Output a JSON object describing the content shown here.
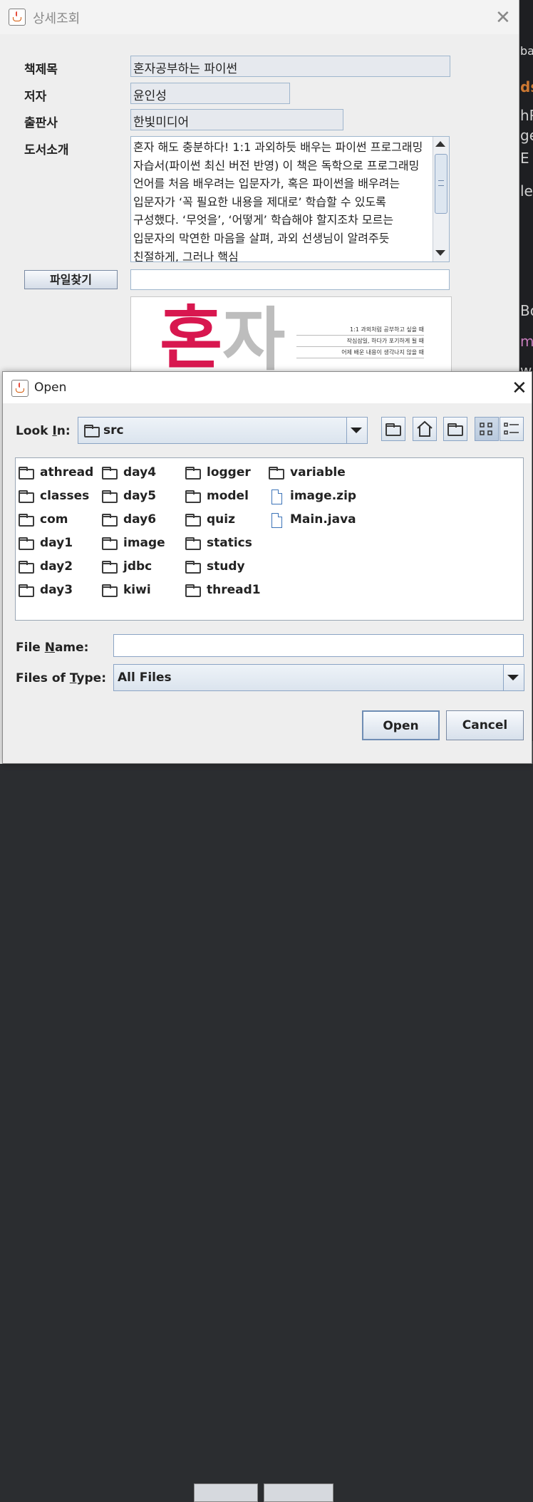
{
  "detail_window": {
    "title": "상세조회",
    "close_glyph": "✕",
    "fields": {
      "title_label": "책제목",
      "title_value": "혼자공부하는 파이썬",
      "author_label": "저자",
      "author_value": "윤인성",
      "publisher_label": "출판사",
      "publisher_value": "한빛미디어",
      "intro_label": "도서소개",
      "intro_text": "혼자 해도 충분하다! 1:1 과외하듯 배우는 파이썬 프로그래밍 자습서(파이썬 최신 버전 반영) 이 책은 독학으로 프로그래밍 언어를 처음 배우려는 입문자가, 혹은 파이썬을 배우려는 입문자가 ‘꼭 필요한 내용을 제대로’ 학습할 수 있도록 구성했다. ‘무엇을’, ‘어떻게’ 학습해야 할지조차 모르는 입문자의 막연한 마음을 살펴, 과외 선생님이 알려주듯 친절하게, 그러나 핵심"
    },
    "file_button_label": "파일찾기",
    "file_path_value": "",
    "cover": {
      "big_char_1": "혼",
      "big_char_2": "자",
      "lines": [
        "1:1 과외처럼 공부하고 싶을 때",
        "작심삼일, 하다가 포기하게 될 때",
        "어제 배운 내용이 생각나지 않을 때"
      ]
    }
  },
  "open_dialog": {
    "title": "Open",
    "close_glyph": "✕",
    "look_in_label_pre": "Look ",
    "look_in_label_u": "I",
    "look_in_label_post": "n:",
    "look_in_value": "src",
    "toolbar": [
      "up-one-level",
      "home",
      "new-folder",
      "list-view",
      "details-view"
    ],
    "files": [
      {
        "name": "athread",
        "type": "folder"
      },
      {
        "name": "classes",
        "type": "folder"
      },
      {
        "name": "com",
        "type": "folder"
      },
      {
        "name": "day1",
        "type": "folder"
      },
      {
        "name": "day2",
        "type": "folder"
      },
      {
        "name": "day3",
        "type": "folder"
      },
      {
        "name": "day4",
        "type": "folder"
      },
      {
        "name": "day5",
        "type": "folder"
      },
      {
        "name": "day6",
        "type": "folder"
      },
      {
        "name": "image",
        "type": "folder"
      },
      {
        "name": "jdbc",
        "type": "folder"
      },
      {
        "name": "kiwi",
        "type": "folder"
      },
      {
        "name": "logger",
        "type": "folder"
      },
      {
        "name": "model",
        "type": "folder"
      },
      {
        "name": "quiz",
        "type": "folder"
      },
      {
        "name": "statics",
        "type": "folder"
      },
      {
        "name": "study",
        "type": "folder"
      },
      {
        "name": "thread1",
        "type": "folder"
      },
      {
        "name": "variable",
        "type": "folder"
      },
      {
        "name": "image.zip",
        "type": "file"
      },
      {
        "name": "Main.java",
        "type": "file"
      }
    ],
    "file_name_label_pre": "File ",
    "file_name_label_u": "N",
    "file_name_label_post": "ame:",
    "file_name_value": "",
    "files_of_type_label_pre": "Files of ",
    "files_of_type_label_u": "T",
    "files_of_type_label_post": "ype:",
    "files_of_type_value": "All Files",
    "open_button": "Open",
    "cancel_button": "Cancel"
  },
  "background": {
    "right_edge_fragments": [
      "ba",
      "ds",
      "hP",
      "ge",
      "E",
      "le",
      "Bo",
      "m",
      "w"
    ]
  }
}
